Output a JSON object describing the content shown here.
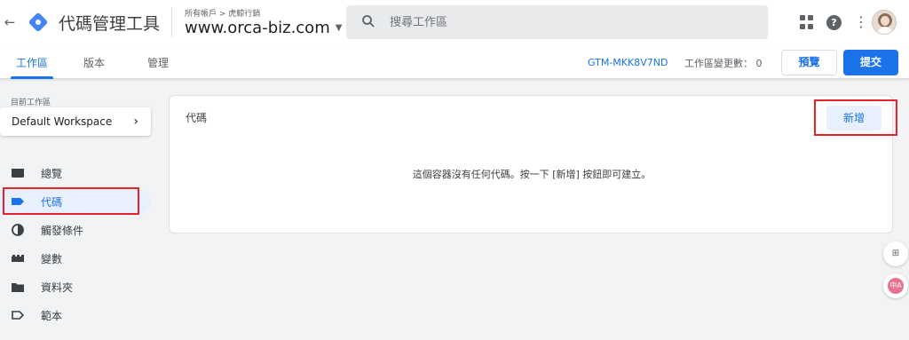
{
  "topbar": {
    "back_glyph": "←",
    "app_title": "代碼管理工具",
    "breadcrumb": "所有帳戶 > 虎鯨行銷",
    "container_name": "www.orca-biz.com",
    "search_placeholder": "搜尋工作區",
    "icons": [
      "arrow-back-icon",
      "gtm-logo-icon",
      "search-icon",
      "apps-grid-icon",
      "help-icon",
      "more-vert-icon",
      "avatar"
    ]
  },
  "tabs": {
    "items": [
      {
        "label": "工作區",
        "active": true
      },
      {
        "label": "版本",
        "active": false
      },
      {
        "label": "管理",
        "active": false
      }
    ],
    "container_id": "GTM-MKK8V7ND",
    "workspace_changes": "工作區變更數： 0",
    "preview_label": "預覽",
    "submit_label": "提交"
  },
  "sidebar": {
    "current_workspace_label": "目前工作區",
    "workspace_name": "Default Workspace",
    "items": [
      {
        "label": "總覽",
        "icon": "overview-icon",
        "active": false
      },
      {
        "label": "代碼",
        "icon": "tag-icon",
        "active": true
      },
      {
        "label": "觸發條件",
        "icon": "trigger-icon",
        "active": false
      },
      {
        "label": "變數",
        "icon": "variables-icon",
        "active": false
      },
      {
        "label": "資料夾",
        "icon": "folder-icon",
        "active": false
      },
      {
        "label": "範本",
        "icon": "template-icon",
        "active": false
      }
    ]
  },
  "main": {
    "card_title": "代碼",
    "new_button_label": "新增",
    "empty_message": "這個容器沒有任何代碼。按一下 [新增] 按鈕即可建立。"
  },
  "floating": {
    "first_glyph": "⊞",
    "second_glyph": "中A"
  },
  "colors": {
    "accent": "#1a73e8",
    "highlight_red": "#e3242b",
    "active_nav_bg": "#e8f0fe"
  }
}
